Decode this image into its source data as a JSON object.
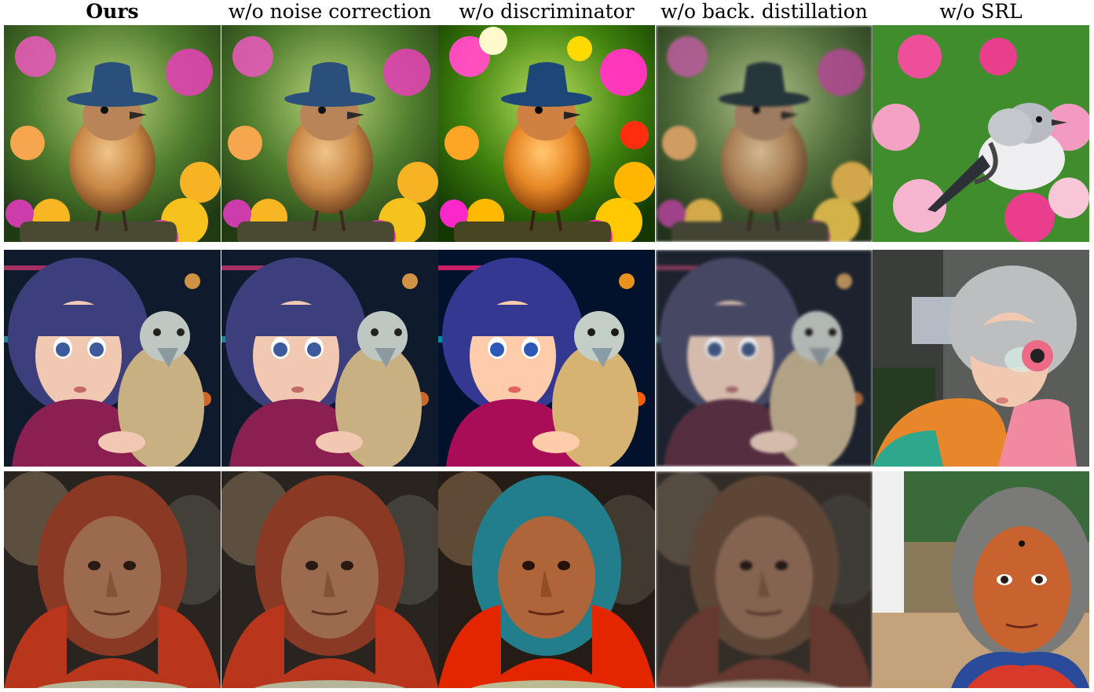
{
  "figure": {
    "columns": [
      {
        "label": "Ours",
        "bold": true,
        "variant": "ours"
      },
      {
        "label": "w/o noise correction",
        "bold": false,
        "variant": "noise"
      },
      {
        "label": "w/o discriminator",
        "bold": false,
        "variant": "disc"
      },
      {
        "label": "w/o back. distillation",
        "bold": false,
        "variant": "backdist"
      },
      {
        "label": "w/o SRL",
        "bold": false,
        "variant": "srl"
      }
    ],
    "rows": [
      {
        "subject": "bird-in-hat",
        "scene": "flower-garden"
      },
      {
        "subject": "girl-with-bird",
        "scene": "neon-night"
      },
      {
        "subject": "elderly-woman",
        "scene": "market"
      }
    ]
  }
}
